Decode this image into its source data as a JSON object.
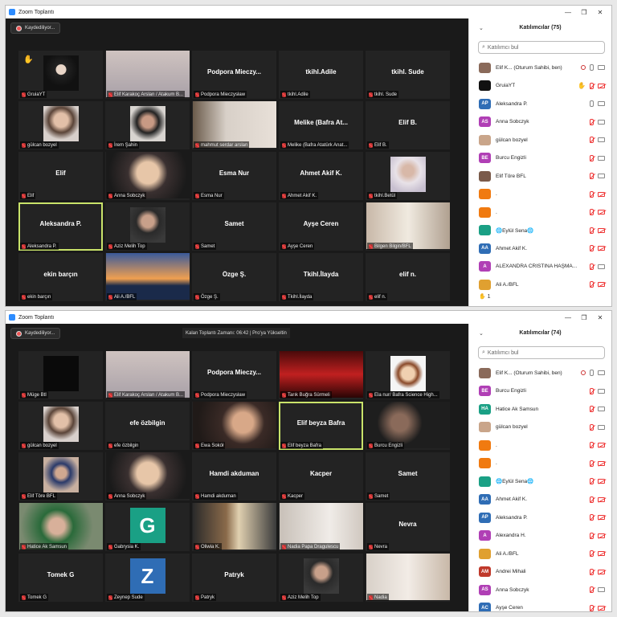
{
  "windows": [
    {
      "title": "Zoom Toplantı",
      "recording_label": "Kaydediliyor...",
      "banner": "",
      "participants_header": "Katılımcılar (75)",
      "search_placeholder": "Katılımcı bul",
      "footer_count": "1",
      "tiles": [
        {
          "name": "",
          "label": "GruiaYT",
          "hand": true,
          "pic": "dark"
        },
        {
          "name": "",
          "label": "Elif Karakoç Arslan / Atakum B...",
          "pic": "wide1"
        },
        {
          "name": "Podpora Mieczy...",
          "label": "Podpora Mieczysław"
        },
        {
          "name": "tkihl.Adile",
          "label": "tkihl.Adile"
        },
        {
          "name": "tkihl. Sude",
          "label": "tkihl. Sude"
        },
        {
          "name": "",
          "label": "gülcan bozyel",
          "pic": "portrait1"
        },
        {
          "name": "",
          "label": "İrem Şahin",
          "pic": "portrait2"
        },
        {
          "name": "",
          "label": "mahmut serdar arslan",
          "pic": "wide2"
        },
        {
          "name": "Melike (Bafra At...",
          "label": "Melike (Bafra Atatürk Anat..."
        },
        {
          "name": "Elif B.",
          "label": "Elif B."
        },
        {
          "name": "Elif",
          "label": "Elif"
        },
        {
          "name": "",
          "label": "Anna Sobczyk",
          "pic": "wide3"
        },
        {
          "name": "Esma Nur",
          "label": "Esma Nur"
        },
        {
          "name": "Ahmet Akif K.",
          "label": "Ahmet Akif K."
        },
        {
          "name": "",
          "label": "tkihl.Betül",
          "pic": "portrait3"
        },
        {
          "name": "Aleksandra P.",
          "label": "Aleksandra P.",
          "highlight": true
        },
        {
          "name": "",
          "label": "Aziz Melih Top",
          "pic": "portrait4"
        },
        {
          "name": "Samet",
          "label": "Samet"
        },
        {
          "name": "Ayşe Ceren",
          "label": "Ayşe Ceren"
        },
        {
          "name": "",
          "label": "Bilgen Bilgin/BFL",
          "pic": "wide4"
        },
        {
          "name": "ekin barçın",
          "label": "ekin barçın"
        },
        {
          "name": "",
          "label": "Ali A./BFL",
          "pic": "sunset"
        },
        {
          "name": "Özge Ş.",
          "label": "Özge Ş."
        },
        {
          "name": "Tkihl.İlayda",
          "label": "Tkihl.İlayda"
        },
        {
          "name": "elif n.",
          "label": "elif n."
        }
      ],
      "participants": [
        {
          "avatar": "",
          "color": "#8a6a5a",
          "name": "Elif K...  (Oturum Sahibi, ben)",
          "icons": [
            "rec",
            "mic",
            "cam"
          ]
        },
        {
          "avatar": "",
          "color": "#111111",
          "name": "GruiaYT",
          "icons": [
            "hand",
            "micoff",
            "camoff"
          ]
        },
        {
          "avatar": "AP",
          "color": "#2f6db5",
          "name": "Aleksandra P.",
          "icons": [
            "mic",
            "cam"
          ]
        },
        {
          "avatar": "AS",
          "color": "#b03fb5",
          "name": "Anna Sobczyk",
          "icons": [
            "micoff",
            "cam"
          ]
        },
        {
          "avatar": "",
          "color": "#c9a58a",
          "name": "gülcan bozyel",
          "icons": [
            "micoff",
            "cam"
          ]
        },
        {
          "avatar": "BE",
          "color": "#b03fb5",
          "name": "Burcu Engizli",
          "icons": [
            "micoff",
            "cam"
          ]
        },
        {
          "avatar": "",
          "color": "#7a5a4a",
          "name": "Elif Töre BFL",
          "icons": [
            "micoff",
            "cam"
          ]
        },
        {
          "avatar": "",
          "color": "#f07a10",
          "name": ".",
          "icons": [
            "micoff",
            "camoff"
          ]
        },
        {
          "avatar": "",
          "color": "#f07a10",
          "name": ".",
          "icons": [
            "micoff",
            "camoff"
          ]
        },
        {
          "avatar": "",
          "color": "#1aa085",
          "name": "🌐Eylül Sena🌐",
          "icons": [
            "micoff",
            "camoff"
          ]
        },
        {
          "avatar": "AA",
          "color": "#2f6db5",
          "name": "Ahmet Akif K.",
          "icons": [
            "micoff",
            "camoff"
          ]
        },
        {
          "avatar": "A",
          "color": "#b03fb5",
          "name": "ALEXANDRA CRISTINA HAŞMĂ...",
          "icons": [
            "micoff",
            "cam"
          ]
        },
        {
          "avatar": "",
          "color": "#e0a030",
          "name": "Ali A./BFL",
          "icons": [
            "micoff",
            "camoff"
          ]
        }
      ]
    },
    {
      "title": "Zoom Toplantı",
      "recording_label": "Kaydediliyor...",
      "banner": "Kalan Toplantı Zamanı: 06:42 | Pro'ya Yükseltin",
      "participants_header": "Katılımcılar (74)",
      "search_placeholder": "Katılımcı bul",
      "footer_count": "",
      "tiles": [
        {
          "name": "",
          "label": "Müge Btl",
          "pic": "black"
        },
        {
          "name": "",
          "label": "Elif Karakoç Arslan / Atakum B...",
          "pic": "wide1"
        },
        {
          "name": "Podpora Mieczy...",
          "label": "Podpora Mieczysław"
        },
        {
          "name": "",
          "label": "Tarık Buğra Sürmeli",
          "pic": "red"
        },
        {
          "name": "",
          "label": "Ela nur/ Bafra Science High...",
          "pic": "cartoon"
        },
        {
          "name": "",
          "label": "gülcan bozyel",
          "pic": "portrait1"
        },
        {
          "name": "efe özbilgin",
          "label": "efe özbilgin"
        },
        {
          "name": "",
          "label": "Ewa Sokół",
          "pic": "wide5"
        },
        {
          "name": "Elif beyza Bafra",
          "label": "Elif beyza Bafra",
          "highlight": true
        },
        {
          "name": "",
          "label": "Burcu Engizli",
          "pic": "wide6"
        },
        {
          "name": "",
          "label": "Elif Töre BFL",
          "pic": "portrait5"
        },
        {
          "name": "",
          "label": "Anna Sobczyk",
          "pic": "wide3"
        },
        {
          "name": "Hamdi akduman",
          "label": "Hamdi akduman"
        },
        {
          "name": "Kacper",
          "label": "Kacper"
        },
        {
          "name": "Samet",
          "label": "Samet"
        },
        {
          "name": "",
          "label": "Hatice Ak Samsun",
          "pic": "wide7"
        },
        {
          "name": "",
          "label": "Gabrysia K.",
          "pic": "letterG"
        },
        {
          "name": "",
          "label": "Oliwia K.",
          "pic": "room"
        },
        {
          "name": "",
          "label": "Nadia Papa Dragulescu",
          "pic": "wide8"
        },
        {
          "name": "Nevra",
          "label": "Nevra"
        },
        {
          "name": "Tomek G",
          "label": "Tomek G"
        },
        {
          "name": "",
          "label": "Zeynep Sude",
          "pic": "letterZ"
        },
        {
          "name": "Patryk",
          "label": "Patryk"
        },
        {
          "name": "",
          "label": "Aziz Melih Top",
          "pic": "portrait4"
        },
        {
          "name": "",
          "label": "Nadia",
          "pic": "wide9"
        }
      ],
      "participants": [
        {
          "avatar": "",
          "color": "#8a6a5a",
          "name": "Elif K...  (Oturum Sahibi, ben)",
          "icons": [
            "rec",
            "mic",
            "cam"
          ]
        },
        {
          "avatar": "BE",
          "color": "#b03fb5",
          "name": "Burcu Engizli",
          "icons": [
            "micoff",
            "cam"
          ]
        },
        {
          "avatar": "HA",
          "color": "#1aa085",
          "name": "Hatice Ak Samsun",
          "icons": [
            "micoff",
            "cam"
          ]
        },
        {
          "avatar": "",
          "color": "#c9a58a",
          "name": "gülcan bozyel",
          "icons": [
            "micoff",
            "cam"
          ]
        },
        {
          "avatar": "",
          "color": "#f07a10",
          "name": ".",
          "icons": [
            "micoff",
            "camoff"
          ]
        },
        {
          "avatar": "",
          "color": "#f07a10",
          "name": ".",
          "icons": [
            "micoff",
            "camoff"
          ]
        },
        {
          "avatar": "",
          "color": "#1aa085",
          "name": "🌐Eylül Sena🌐",
          "icons": [
            "micoff",
            "camoff"
          ]
        },
        {
          "avatar": "AA",
          "color": "#2f6db5",
          "name": "Ahmet Akif K.",
          "icons": [
            "micoff",
            "camoff"
          ]
        },
        {
          "avatar": "AP",
          "color": "#2f6db5",
          "name": "Aleksandra P.",
          "icons": [
            "micoff",
            "camoff"
          ]
        },
        {
          "avatar": "A",
          "color": "#b03fb5",
          "name": "Alexandra H.",
          "icons": [
            "micoff",
            "camoff"
          ]
        },
        {
          "avatar": "",
          "color": "#e0a030",
          "name": "Ali A./BFL",
          "icons": [
            "micoff",
            "camoff"
          ]
        },
        {
          "avatar": "AM",
          "color": "#c0392b",
          "name": "Andrei Mihali",
          "icons": [
            "micoff",
            "camoff"
          ]
        },
        {
          "avatar": "AS",
          "color": "#b03fb5",
          "name": "Anna Sobczyk",
          "icons": [
            "micoff",
            "cam"
          ]
        },
        {
          "avatar": "AC",
          "color": "#2f6db5",
          "name": "Ayşe Ceren",
          "icons": [
            "micoff",
            "camoff"
          ]
        }
      ]
    }
  ]
}
